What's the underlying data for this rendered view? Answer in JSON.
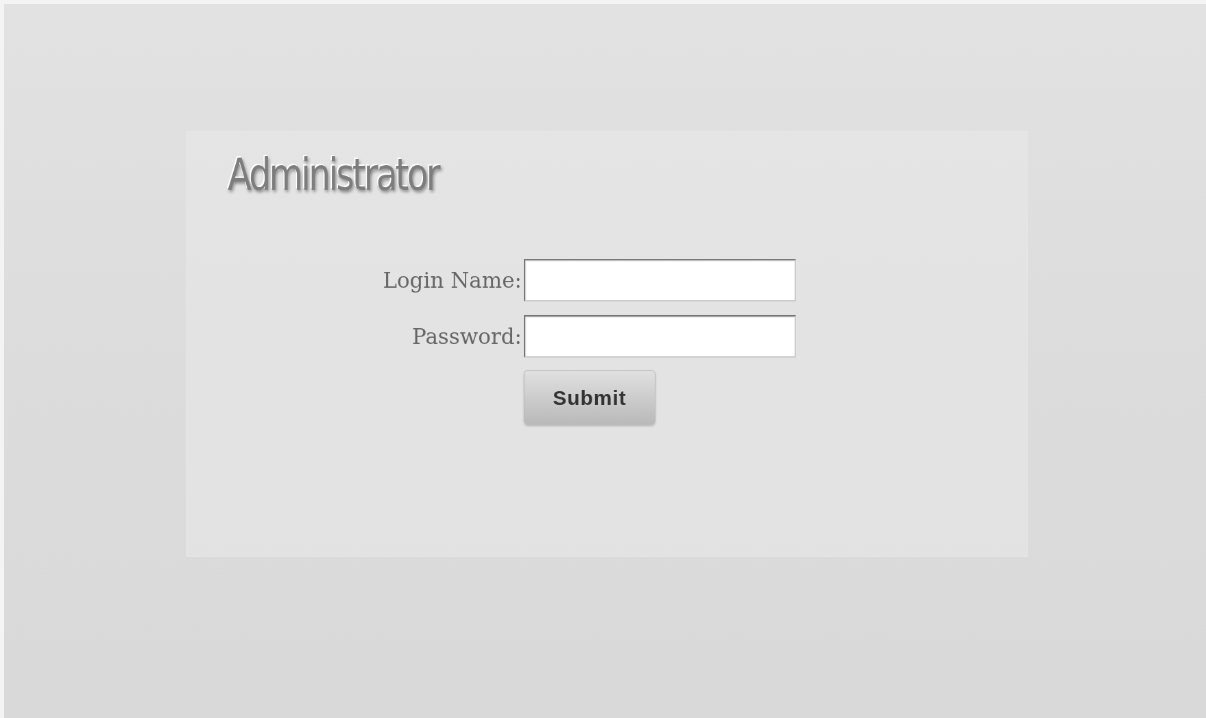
{
  "title": "Administrator",
  "fields": [
    {
      "label": "Login Name:"
    },
    {
      "label": "Password:"
    }
  ],
  "submit": "Submit"
}
